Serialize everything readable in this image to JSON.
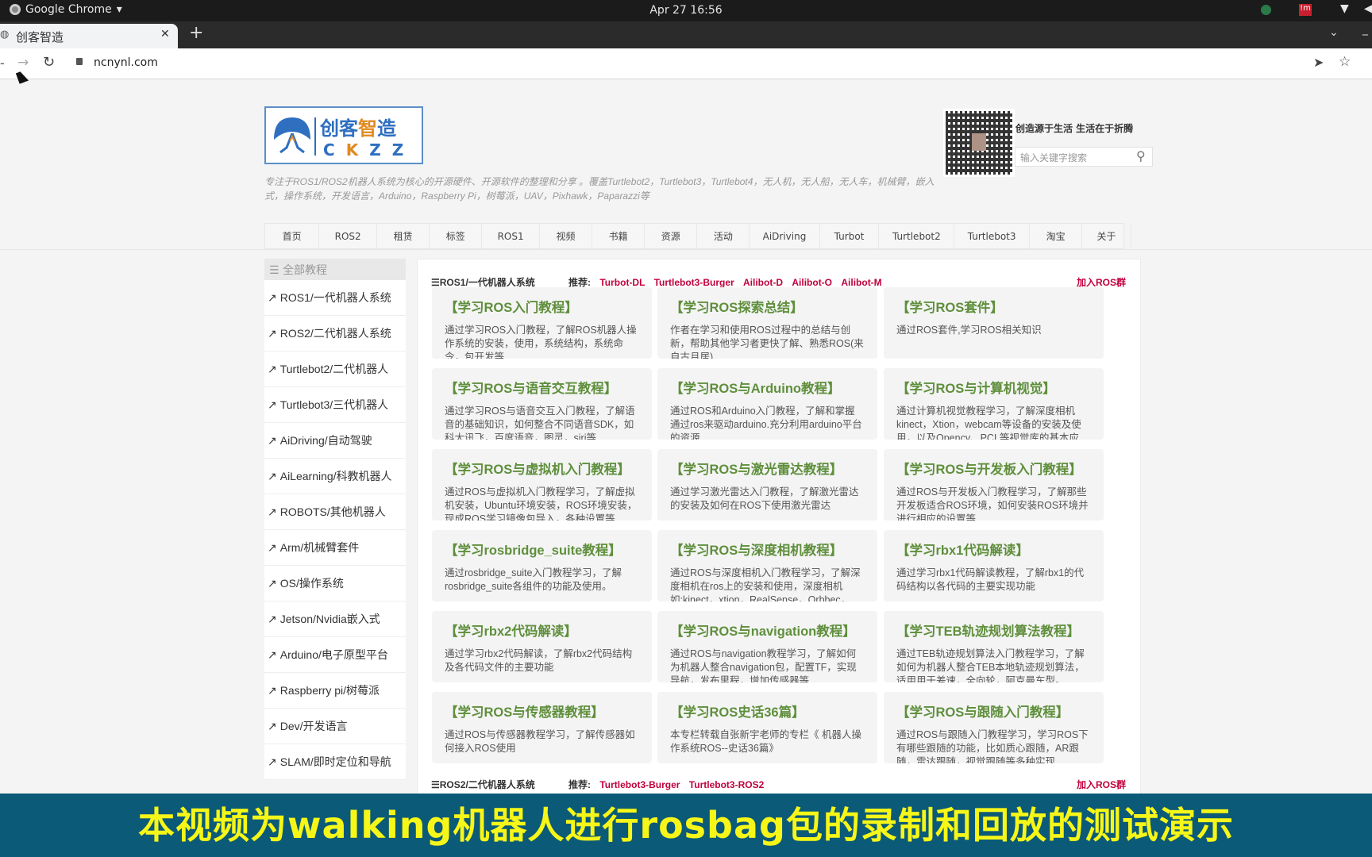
{
  "system": {
    "app_name": "Google Chrome",
    "clock": "Apr 27  16:56"
  },
  "browser": {
    "tab_title": "创客智造",
    "url": "ncnynl.com"
  },
  "header": {
    "logo_text": "创客智造 CKZZ",
    "description": "专注于ROS1/ROS2机器人系统为核心的开源硬件、开源软件的整理和分享 。覆盖Turtlebot2，Turtlebot3，Turtlebot4，无人机，无人船，无人车，机械臂，嵌入式，操作系统，开发语言，Arduino，Raspberry Pi，树莓派，UAV，Pixhawk，Paparazzi等",
    "slogan": "创造源于生活 生活在于折腾",
    "search_placeholder": "输入关键字搜索"
  },
  "nav": [
    "首页",
    "ROS2",
    "租赁",
    "标签",
    "ROS1",
    "视频",
    "书籍",
    "资源",
    "活动",
    "AiDriving",
    "Turbot",
    "Turtlebot2",
    "Turtlebot3",
    "淘宝",
    "关于"
  ],
  "sidebar": {
    "title": "全部教程",
    "items": [
      "ROS1/一代机器人系统",
      "ROS2/二代机器人系统",
      "Turtlebot2/二代机器人",
      "Turtlebot3/三代机器人",
      "AiDriving/自动驾驶",
      "AiLearning/科教机器人",
      "ROBOTS/其他机器人",
      "Arm/机械臂套件",
      "OS/操作系统",
      "Jetson/Nvidia嵌入式",
      "Arduino/电子原型平台",
      "Raspberry pi/树莓派",
      "Dev/开发语言",
      "SLAM/即时定位和导航"
    ]
  },
  "sections": [
    {
      "title": "ROS1/一代机器人系统",
      "recommend_label": "推荐:",
      "recommend": [
        "Turbot-DL",
        "Turtlebot3-Burger",
        "Ailibot-D",
        "Ailibot-O",
        "Ailibot-M"
      ],
      "join": "加入ROS群",
      "cards": [
        {
          "title": "【学习ROS入门教程】",
          "desc": "通过学习ROS入门教程，了解ROS机器人操作系统的安装，使用，系统结构，系统命令，包开发等"
        },
        {
          "title": "【学习ROS探索总结】",
          "desc": "作者在学习和使用ROS过程中的总结与创新，帮助其他学习者更快了解、熟悉ROS(来自古月居)"
        },
        {
          "title": "【学习ROS套件】",
          "desc": "通过ROS套件,学习ROS相关知识"
        },
        {
          "title": "【学习ROS与语音交互教程】",
          "desc": "通过学习ROS与语音交互入门教程，了解语音的基础知识，如何整合不同语音SDK，如科大讯飞，百度语音，图灵，siri等"
        },
        {
          "title": "【学习ROS与Arduino教程】",
          "desc": "通过ROS和Arduino入门教程，了解和掌握通过ros来驱动arduino.充分利用arduino平台的资源"
        },
        {
          "title": "【学习ROS与计算机视觉】",
          "desc": "通过计算机视觉教程学习，了解深度相机kinect，Xtion，webcam等设备的安装及使用，以及Opencv、PCL等视觉库的基本应"
        },
        {
          "title": "【学习ROS与虚拟机入门教程】",
          "desc": "通过ROS与虚拟机入门教程学习，了解虚拟机安装，Ubuntu环境安装，ROS环境安装，现成ROS学习镜像包导入，各种设置等"
        },
        {
          "title": "【学习ROS与激光雷达教程】",
          "desc": "通过学习激光雷达入门教程，了解激光雷达的安装及如何在ROS下使用激光雷达"
        },
        {
          "title": "【学习ROS与开发板入门教程】",
          "desc": "通过ROS与开发板入门教程学习，了解那些开发板适合ROS环境，如何安装ROS环境并进行相应的设置等"
        },
        {
          "title": "【学习rosbridge_suite教程】",
          "desc": "通过rosbridge_suite入门教程学习，了解rosbridge_suite各组件的功能及使用。"
        },
        {
          "title": "【学习ROS与深度相机教程】",
          "desc": "通过ROS与深度相机入门教程学习，了解深度相机在ros上的安装和使用，深度相机如:kinect，xtion，RealSense，Orbbec，"
        },
        {
          "title": "【学习rbx1代码解读】",
          "desc": "通过学习rbx1代码解读教程，了解rbx1的代码结构以各代码的主要实现功能"
        },
        {
          "title": "【学习rbx2代码解读】",
          "desc": "通过学习rbx2代码解读，了解rbx2代码结构及各代码文件的主要功能"
        },
        {
          "title": "【学习ROS与navigation教程】",
          "desc": "通过ROS与navigation教程学习，了解如何为机器人整合navigation包，配置TF，实现导航，发布里程，增加传感器等"
        },
        {
          "title": "【学习TEB轨迹规划算法教程】",
          "desc": "通过TEB轨迹规划算法入门教程学习，了解如何为机器人整合TEB本地轨迹规划算法，适用用于差速，全向轮，阿克曼车型。"
        },
        {
          "title": "【学习ROS与传感器教程】",
          "desc": "通过ROS与传感器教程学习，了解传感器如何接入ROS使用"
        },
        {
          "title": "【学习ROS史话36篇】",
          "desc": "本专栏转载自张新宇老师的专栏《 机器人操作系统ROS--史话36篇》"
        },
        {
          "title": "【学习ROS与跟随入门教程】",
          "desc": "通过ROS与跟随入门教程学习，学习ROS下有哪些跟随的功能，比如质心跟随，AR跟随，雷达跟随，视觉跟随等多种实现"
        }
      ]
    },
    {
      "title": "ROS2/二代机器人系统",
      "recommend_label": "推荐:",
      "recommend": [
        "Turtlebot3-Burger",
        "Turtlebot3-ROS2"
      ],
      "join": "加入ROS群"
    }
  ],
  "banner": {
    "text": "本视频为walking机器人进行rosbag包的录制和回放的测试演示"
  },
  "colors": {
    "banner_bg": "#0b5a77",
    "banner_text": "#f6f618",
    "card_title": "#5f8f3c",
    "recommend_link": "#c0003c"
  }
}
